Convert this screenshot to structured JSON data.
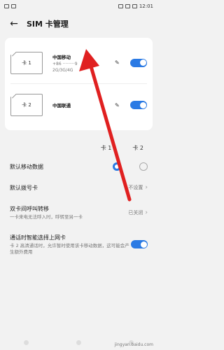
{
  "status": {
    "left_text": "",
    "time": "12:01"
  },
  "header": {
    "title": "SIM 卡管理"
  },
  "sims": [
    {
      "card_label": "卡 1",
      "name": "中国移动",
      "number": "+86 ·········9",
      "network": "2G/3G/4G"
    },
    {
      "card_label": "卡 2",
      "name": "中国联通",
      "number": "",
      "network": ""
    }
  ],
  "card_headers": [
    "卡 1",
    "卡 2"
  ],
  "settings": {
    "default_data": {
      "label": "默认移动数据"
    },
    "default_dial": {
      "label": "默认拨号卡",
      "value": "不设置"
    },
    "call_forward": {
      "label": "双卡间呼叫转移",
      "sub": "一卡来电无法呼入时，呼转至另一卡",
      "value": "已关闭"
    },
    "smart_data": {
      "label": "通话时智能选择上网卡",
      "sub": "卡 2 高清通话时，允许暂时使用该卡移动数据，这可能会产生额外费用"
    }
  },
  "watermark": "jingyan.baidu.com",
  "colors": {
    "accent": "#2a7ae4",
    "annotation": "#e02020"
  }
}
